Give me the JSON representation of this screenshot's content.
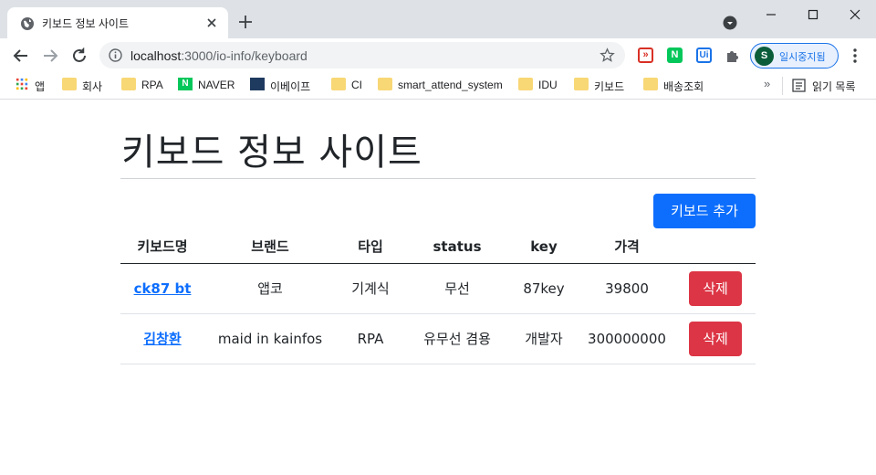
{
  "browser": {
    "tab_title": "키보드 정보 사이트",
    "url_host": "localhost",
    "url_rest": ":3000/io-info/keyboard",
    "profile_initial": "S",
    "profile_label": "일시중지됨",
    "extensions": [
      {
        "name": "ext-red",
        "glyph": "»",
        "color": "#d93025"
      },
      {
        "name": "ext-naver",
        "glyph": "N",
        "color": "#03c75a"
      },
      {
        "name": "ext-ui",
        "glyph": "Ui",
        "color": "#1a73e8"
      }
    ],
    "icons": {
      "back": "back-arrow-icon",
      "forward": "forward-arrow-icon",
      "reload": "reload-icon",
      "info": "info-icon",
      "star": "star-icon",
      "puzzle": "puzzle-icon",
      "kebab": "kebab-menu-icon"
    }
  },
  "bookmarks": {
    "items": [
      {
        "label": "앱",
        "icon": "apps-grid-icon"
      },
      {
        "label": "회사",
        "icon": "folder-icon"
      },
      {
        "label": "RPA",
        "icon": "folder-icon"
      },
      {
        "label": "NAVER",
        "icon": "naver-icon"
      },
      {
        "label": "이베이프",
        "icon": "site-icon"
      },
      {
        "label": "CI",
        "icon": "folder-icon"
      },
      {
        "label": "smart_attend_system",
        "icon": "folder-icon"
      },
      {
        "label": "IDU",
        "icon": "folder-icon"
      },
      {
        "label": "키보드",
        "icon": "folder-icon"
      },
      {
        "label": "배송조회",
        "icon": "folder-icon"
      }
    ],
    "more": "»",
    "reading_list": "읽기 목록"
  },
  "page": {
    "title": "키보드 정보 사이트",
    "add_button": "키보드 추가",
    "table": {
      "headers": [
        "키보드명",
        "브랜드",
        "타입",
        "status",
        "key",
        "가격",
        ""
      ],
      "rows": [
        {
          "name": "ck87 bt",
          "brand": "앱코",
          "type": "기계식",
          "status": "무선",
          "key": "87key",
          "price": "39800",
          "action": "삭제"
        },
        {
          "name": "김창환",
          "brand": "maid in kainfos",
          "type": "RPA",
          "status": "유무선 겸용",
          "key": "개발자",
          "price": "300000000",
          "action": "삭제"
        }
      ]
    }
  },
  "colors": {
    "primary": "#0d6efd",
    "danger": "#dc3545",
    "tabstrip": "#dee1e6"
  }
}
